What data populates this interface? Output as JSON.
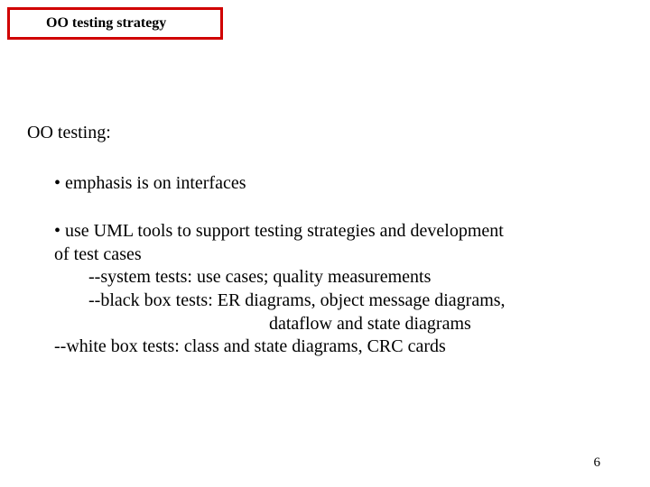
{
  "title": "OO testing strategy",
  "heading": "OO testing:",
  "bullet1": "• emphasis is on interfaces",
  "bullet2_line1": "• use UML tools to support testing strategies and development",
  "bullet2_line2": "of test cases",
  "sub1": "--system tests:  use cases; quality measurements",
  "sub2": "--black box tests:  ER diagrams, object message diagrams,",
  "sub2_cont": "dataflow and state diagrams",
  "sub3": "--white box tests:  class and state diagrams, CRC cards",
  "page_number": "6"
}
